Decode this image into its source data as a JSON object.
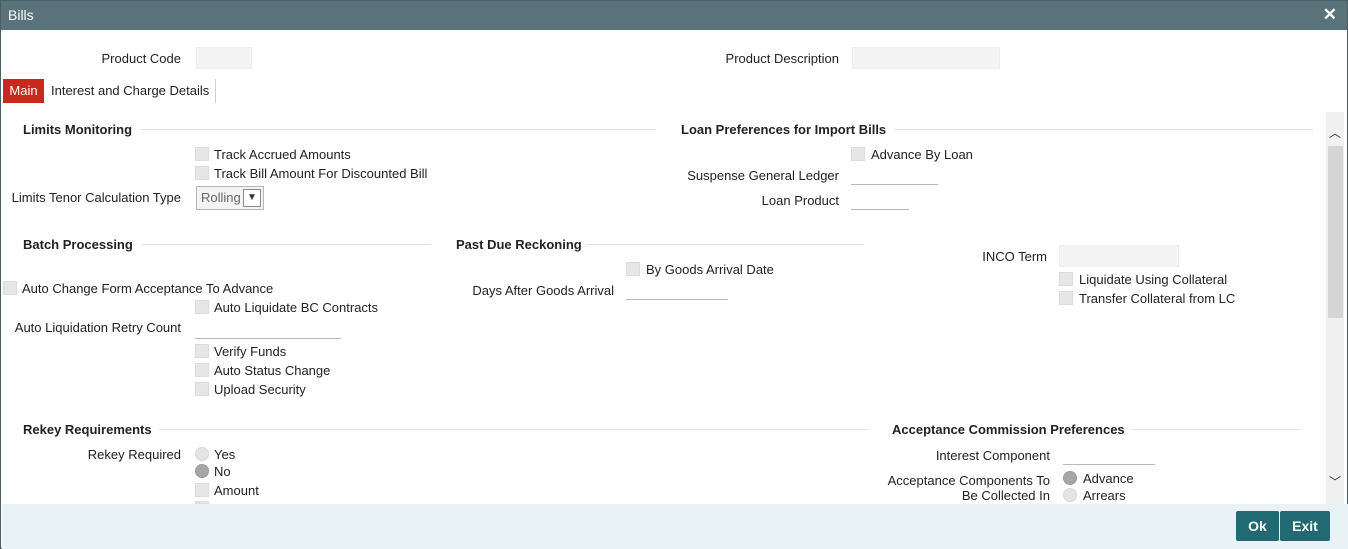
{
  "window": {
    "title": "Bills"
  },
  "header": {
    "product_code_label": "Product Code",
    "product_code_value": "",
    "product_description_label": "Product Description",
    "product_description_value": ""
  },
  "tabs": [
    {
      "label": "Main",
      "active": true
    },
    {
      "label": "Interest and Charge Details",
      "active": false
    }
  ],
  "limits": {
    "section_title": "Limits Monitoring",
    "track_accrued": "Track Accrued Amounts",
    "track_bill": "Track Bill Amount For Discounted Bill",
    "tenor_label": "Limits Tenor Calculation Type",
    "tenor_value": "Rolling"
  },
  "loan_prefs": {
    "section_title": "Loan Preferences for Import Bills",
    "advance_by_loan": "Advance By Loan",
    "suspense_gl_label": "Suspense General Ledger",
    "loan_product_label": "Loan Product"
  },
  "batch": {
    "section_title": "Batch Processing",
    "auto_change": "Auto Change Form Acceptance To Advance",
    "auto_liquidate": "Auto Liquidate BC Contracts",
    "retry_label": "Auto Liquidation Retry Count",
    "verify_funds": "Verify Funds",
    "auto_status": "Auto Status Change",
    "upload_security": "Upload Security"
  },
  "past_due": {
    "section_title": "Past Due Reckoning",
    "by_goods_arrival": "By Goods Arrival Date",
    "days_after_label": "Days After Goods Arrival"
  },
  "inco": {
    "label": "INCO Term",
    "liquidate_collateral": "Liquidate Using Collateral",
    "transfer_collateral": "Transfer Collateral from LC"
  },
  "rekey": {
    "section_title": "Rekey Requirements",
    "required_label": "Rekey Required",
    "yes": "Yes",
    "no": "No",
    "selected": "No",
    "amount": "Amount"
  },
  "acceptance": {
    "section_title": "Acceptance Commission Preferences",
    "interest_component_label": "Interest Component",
    "collected_label_line1": "Acceptance Components To",
    "collected_label_line2": "Be Collected In",
    "advance": "Advance",
    "arrears": "Arrears",
    "selected": "Advance"
  },
  "footer": {
    "ok": "Ok",
    "exit": "Exit"
  },
  "icons": {
    "close": "close-icon",
    "scroll_up": "chevron-up-icon",
    "scroll_down": "chevron-down-icon",
    "dropdown": "chevron-down-icon"
  },
  "colors": {
    "titlebar": "#5a7279",
    "active_tab": "#c9291c",
    "button": "#226a73",
    "footer": "#e9f2f5"
  }
}
